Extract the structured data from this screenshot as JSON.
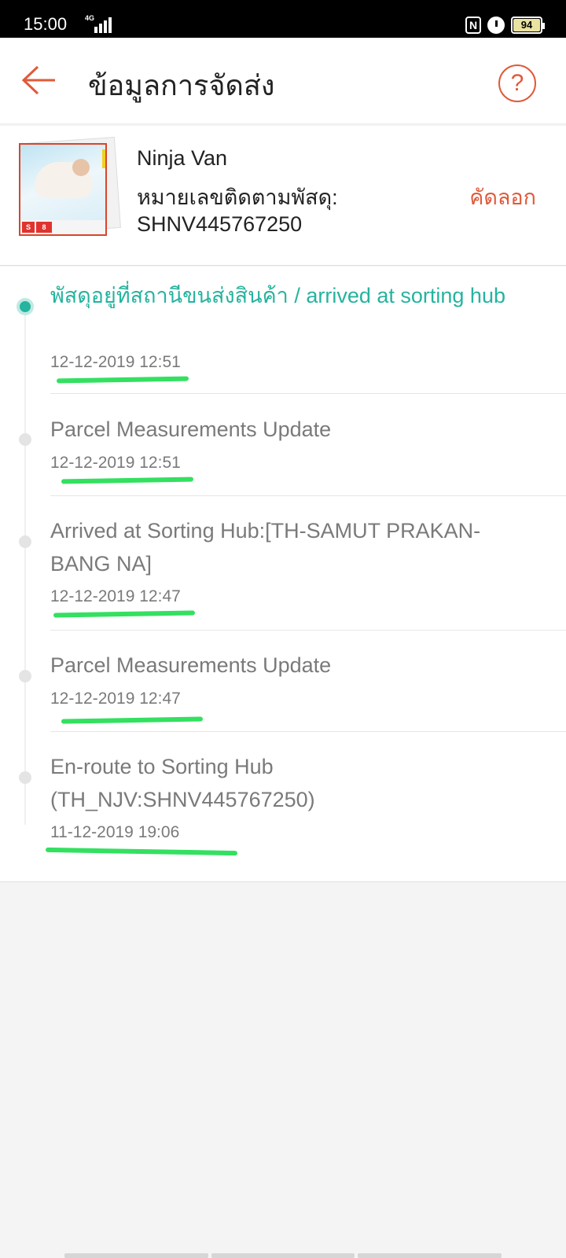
{
  "status_bar": {
    "time": "15:00",
    "network": "4G",
    "battery": "94",
    "icons": [
      "signal-icon",
      "nfc-icon",
      "alarm-icon",
      "battery-icon"
    ]
  },
  "header": {
    "title": "ข้อมูลการจัดส่ง",
    "back_icon": "arrow-left-icon",
    "help_label": "?"
  },
  "shipment": {
    "carrier": "Ninja Van",
    "tracking_label": "หมายเลขติดตามพัสดุ:",
    "tracking_number": "SHNV445767250",
    "copy_label": "คัดลอก"
  },
  "timeline": {
    "events": [
      {
        "status": "พัสดุอยู่ที่สถานีขนส่งสินค้า / arrived at sorting hub",
        "time": "12-12-2019 12:51",
        "active": true
      },
      {
        "status": "Parcel Measurements Update",
        "time": "12-12-2019 12:51",
        "active": false
      },
      {
        "status": "Arrived at Sorting Hub:[TH-SAMUT PRAKAN-BANG NA]",
        "time": "12-12-2019 12:47",
        "active": false
      },
      {
        "status": "Parcel Measurements Update",
        "time": "12-12-2019 12:47",
        "active": false
      },
      {
        "status": "En-route to Sorting Hub (TH_NJV:SHNV445767250)",
        "time": "11-12-2019 19:06",
        "active": false
      }
    ]
  },
  "colors": {
    "accent": "#e05a3a",
    "active_status": "#26b39f",
    "muted_text": "#7a7a7a",
    "highlight_marker": "#33e060"
  }
}
